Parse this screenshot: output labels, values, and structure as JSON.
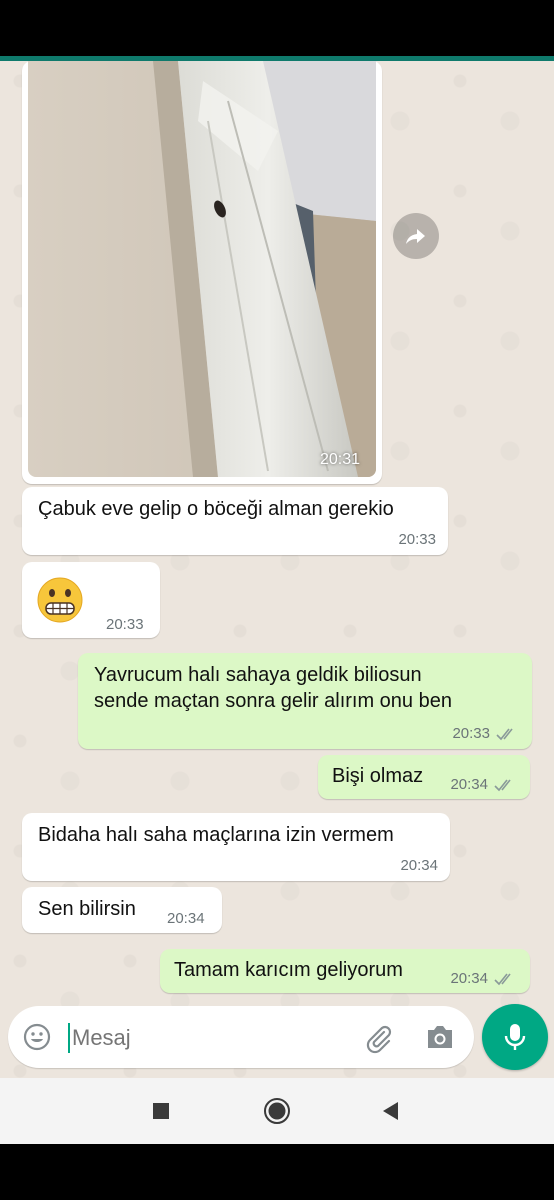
{
  "messages": [
    {
      "id": "photo",
      "direction": "in",
      "time": "20:31"
    },
    {
      "id": "m1",
      "direction": "in",
      "text": "Çabuk eve gelip o böceği alman gerekio",
      "time": "20:33"
    },
    {
      "id": "m2",
      "direction": "in",
      "emoji": "grimacing-face",
      "time": "20:33"
    },
    {
      "id": "m3",
      "direction": "out",
      "line1": "Yavrucum halı sahaya geldik biliosun",
      "line2": "sende maçtan sonra gelir alırım onu ben",
      "time": "20:33"
    },
    {
      "id": "m4",
      "direction": "out",
      "text": "Bişi olmaz",
      "time": "20:34"
    },
    {
      "id": "m5",
      "direction": "in",
      "text": "Bidaha halı saha maçlarına izin vermem",
      "time": "20:34"
    },
    {
      "id": "m6",
      "direction": "in",
      "text": "Sen bilirsin",
      "time": "20:34"
    },
    {
      "id": "m7",
      "direction": "out",
      "text": "Tamam karıcım geliyorum",
      "time": "20:34"
    }
  ],
  "input": {
    "placeholder": "Mesaj"
  },
  "colors": {
    "accent": "#00a884",
    "outgoing": "#dcf8c6",
    "incoming": "#ffffff",
    "background": "#ece5dd"
  },
  "icons": [
    "forward-icon",
    "emoji-icon",
    "attach-icon",
    "camera-icon",
    "mic-icon",
    "nav-square-icon",
    "nav-home-icon",
    "nav-back-icon"
  ]
}
